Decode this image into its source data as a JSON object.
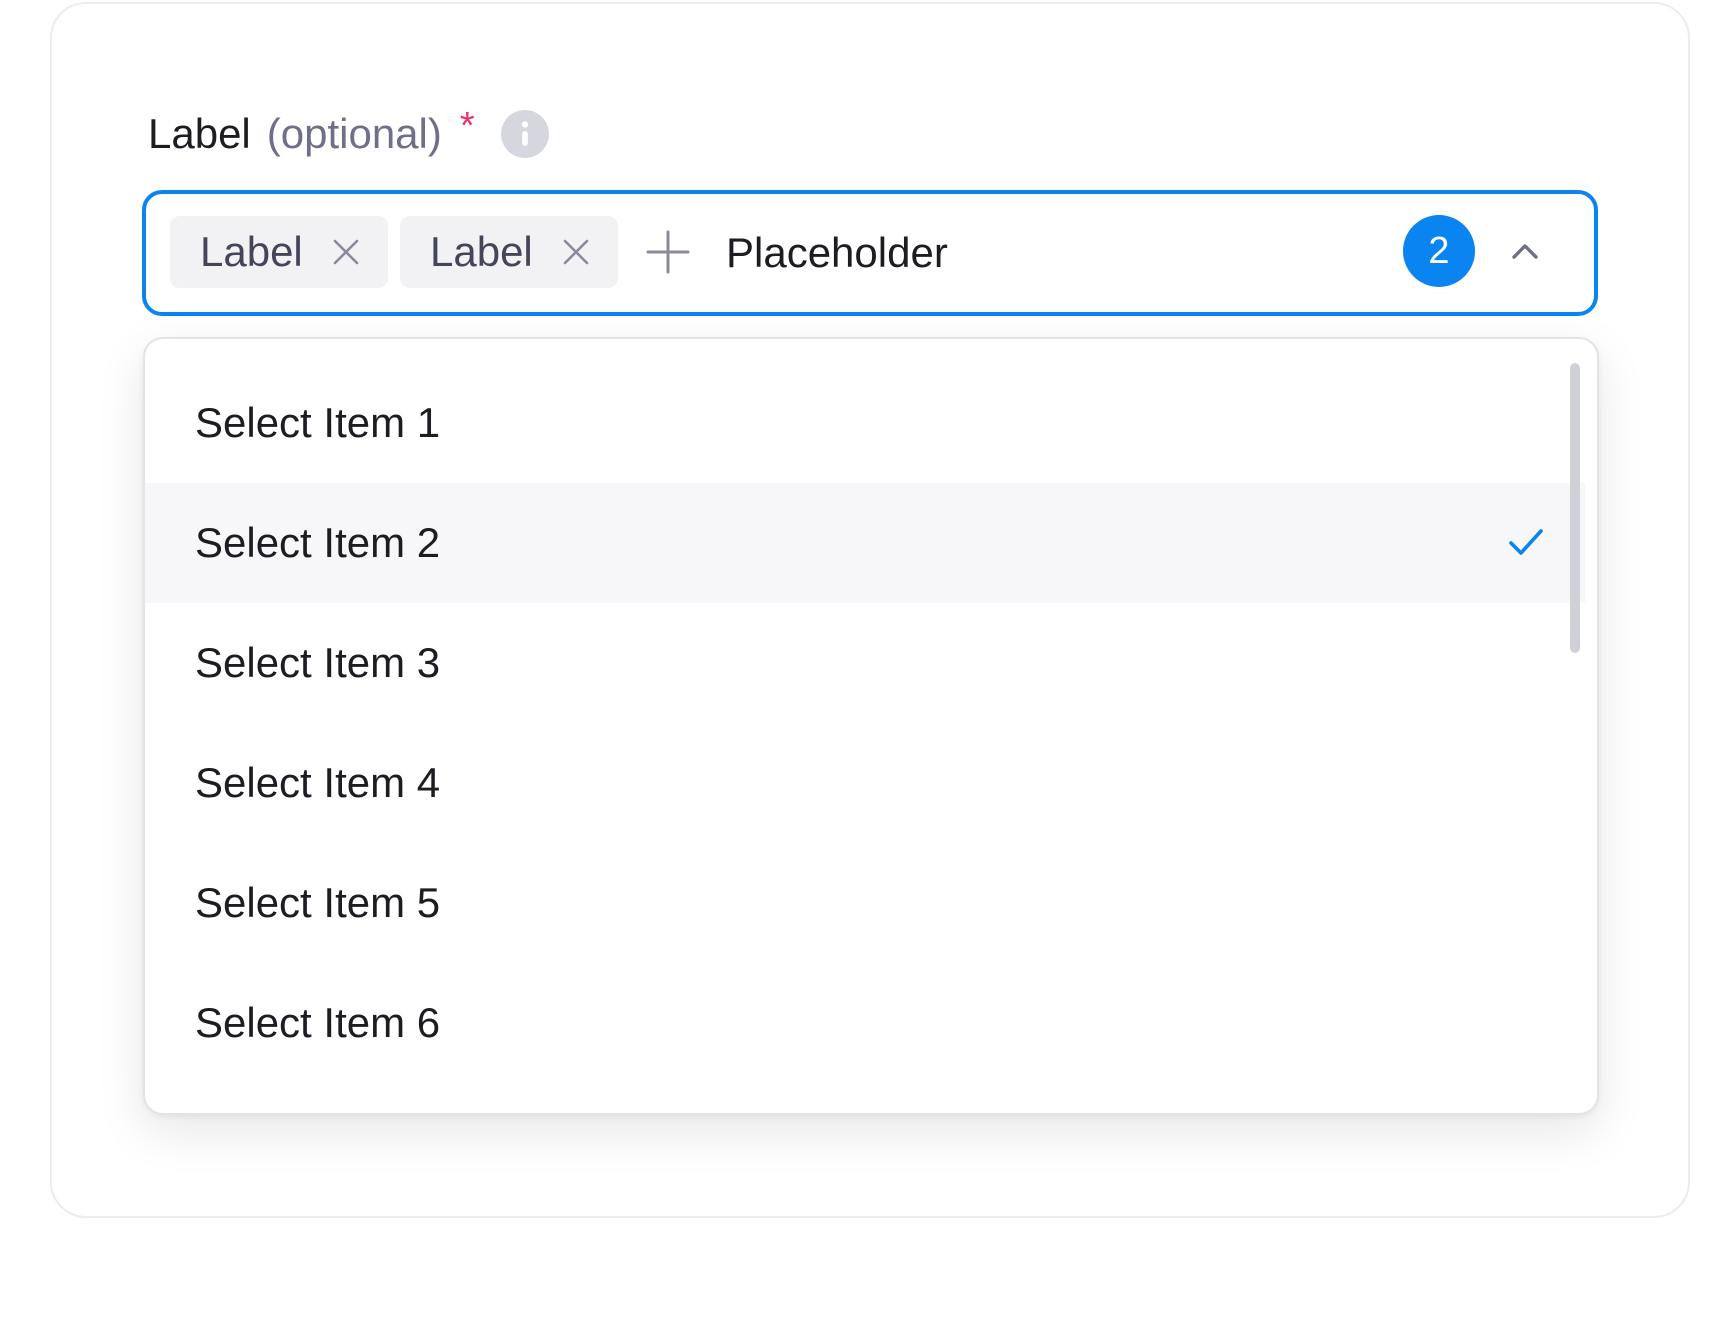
{
  "field": {
    "label": "Label",
    "optional_text": "(optional)",
    "required_marker": "*",
    "info_icon": "info-icon"
  },
  "select": {
    "tags": [
      {
        "label": "Label",
        "remove_icon": "close-icon"
      },
      {
        "label": "Label",
        "remove_icon": "close-icon"
      }
    ],
    "add_icon": "plus-icon",
    "placeholder": "Placeholder",
    "selected_count": "2",
    "toggle_icon": "chevron-up-icon",
    "accent_color": "#0a84f0"
  },
  "dropdown": {
    "options": [
      {
        "label": "Select Item 1",
        "selected": false
      },
      {
        "label": "Select Item 2",
        "selected": true
      },
      {
        "label": "Select Item 3",
        "selected": false
      },
      {
        "label": "Select Item 4",
        "selected": false
      },
      {
        "label": "Select Item 5",
        "selected": false
      },
      {
        "label": "Select Item 6",
        "selected": false
      }
    ],
    "selected_icon": "check-icon",
    "scroll_position": 0
  },
  "colors": {
    "accent": "#0a84f0",
    "required": "#e8336b",
    "optional_text": "#6f6f88",
    "tag_background": "#f2f2f5",
    "selected_row_background": "#f7f7f9"
  }
}
